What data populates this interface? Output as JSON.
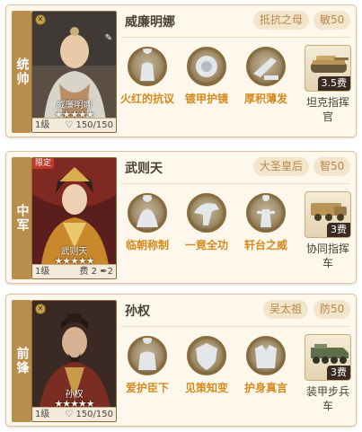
{
  "generals": [
    {
      "position": "统帅",
      "name": "威廉明娜",
      "card_name": "威廉明娜",
      "stars": "★★★★★",
      "level": "1级",
      "hp": "150/150",
      "title_tag": "抵抗之母",
      "stat_tag": "敏50",
      "skills": [
        {
          "label": "火红的抗议",
          "icon": "statue-icon"
        },
        {
          "label": "镀甲护镜",
          "icon": "shield-orb-icon"
        },
        {
          "label": "厚积薄发",
          "icon": "cannon-icon"
        }
      ],
      "troop": {
        "label": "坦克指挥官",
        "cost": "3.5费",
        "icon": "tank-icon"
      }
    },
    {
      "position": "中军",
      "name": "武则天",
      "card_name": "武则天",
      "stars": "★★★★★",
      "level": "1级",
      "limit_tag": "限定",
      "cost_info": "费 2",
      "slot_info": "2",
      "title_tag": "大圣皇后",
      "stat_tag": "智50",
      "skills": [
        {
          "label": "临朝称制",
          "icon": "empress-icon"
        },
        {
          "label": "一竟全功",
          "icon": "horse-icon"
        },
        {
          "label": "轩台之威",
          "icon": "figure-icon"
        }
      ],
      "troop": {
        "label": "协同指挥车",
        "cost": "3费",
        "icon": "command-vehicle-icon"
      }
    },
    {
      "position": "前锋",
      "name": "孙权",
      "card_name": "孙权",
      "stars": "★★★★★",
      "level": "1级",
      "hp": "150/150",
      "title_tag": "吴太祖",
      "stat_tag": "防50",
      "skills": [
        {
          "label": "爱护臣下",
          "icon": "guard-icon"
        },
        {
          "label": "见策知变",
          "icon": "shield-icon"
        },
        {
          "label": "护身真言",
          "icon": "armor-icon"
        }
      ],
      "troop": {
        "label": "装甲步兵车",
        "cost": "3费",
        "icon": "apc-icon"
      }
    }
  ]
}
